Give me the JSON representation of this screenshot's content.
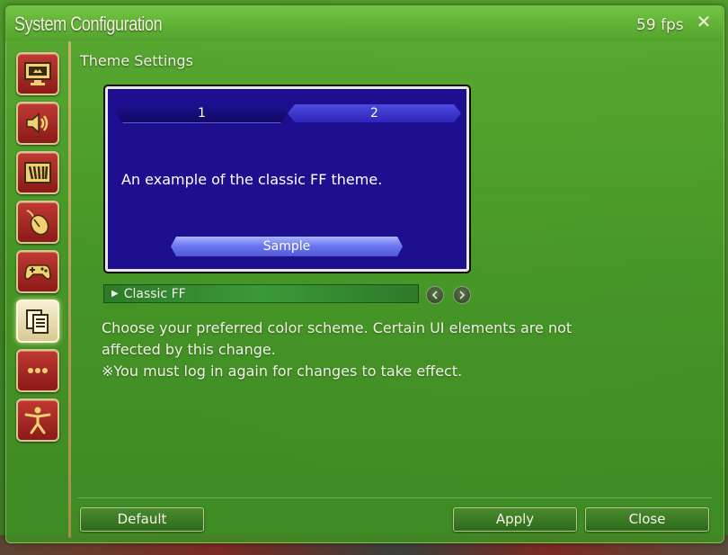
{
  "window": {
    "title": "System Configuration",
    "fps": "59 fps",
    "close_glyph": "✕"
  },
  "sidebar": {
    "items": [
      {
        "name": "display-settings",
        "icon": "monitor-upload-icon"
      },
      {
        "name": "sound-settings",
        "icon": "speaker-icon"
      },
      {
        "name": "other-settings",
        "icon": "gauge-bars-icon"
      },
      {
        "name": "mouse-settings",
        "icon": "mouse-icon"
      },
      {
        "name": "gamepad-settings",
        "icon": "gamepad-icon"
      },
      {
        "name": "theme-settings",
        "icon": "documents-icon",
        "active": true
      },
      {
        "name": "more-settings",
        "icon": "ellipsis-icon"
      },
      {
        "name": "accessibility-settings",
        "icon": "figure-icon"
      }
    ]
  },
  "section": {
    "title": "Theme Settings"
  },
  "preview": {
    "tabs": [
      "1",
      "2"
    ],
    "text": "An example of the classic FF theme.",
    "sample_button": "Sample"
  },
  "theme_select": {
    "arrow": "▶",
    "value": "Classic FF"
  },
  "description": {
    "line1": "Choose your preferred color scheme. Certain UI elements are not",
    "line2": "affected by this change.",
    "line3": "※You must log in again for changes to take effect."
  },
  "footer": {
    "default_label": "Default",
    "apply_label": "Apply",
    "close_label": "Close"
  },
  "colors": {
    "window_green": "#4f9a2c",
    "preview_blue": "#1d0f8f",
    "sidebar_red": "#a82a26",
    "sample_button": "#6d78ef"
  }
}
